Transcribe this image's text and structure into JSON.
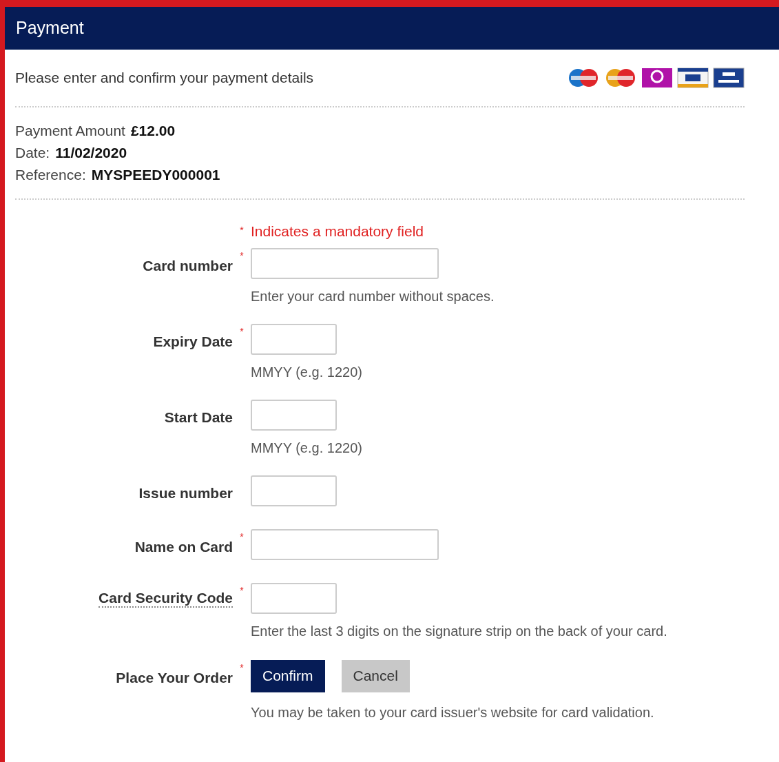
{
  "header": {
    "title": "Payment"
  },
  "intro": "Please enter and confirm your payment details",
  "card_logos": [
    {
      "kind": "circles",
      "color": "#1a73c9"
    },
    {
      "kind": "circles",
      "color": "#e8a21a"
    },
    {
      "kind": "swirl",
      "color": "#b012a8"
    },
    {
      "kind": "striped",
      "color": "#1a3f8f"
    },
    {
      "kind": "plain",
      "color": "#1a3f8f"
    }
  ],
  "summary": [
    {
      "label": "Payment Amount",
      "value": "£12.00"
    },
    {
      "label": "Date:",
      "value": "11/02/2020"
    },
    {
      "label": "Reference:",
      "value": "MYSPEEDY000001"
    }
  ],
  "mandatory_note": {
    "mark": "*",
    "text": "Indicates a mandatory field"
  },
  "fields": [
    {
      "label": "Card number",
      "required": true,
      "kind": "wide",
      "dotted": false,
      "help": "Enter your card number without spaces."
    },
    {
      "label": "Expiry Date",
      "required": true,
      "kind": "short",
      "dotted": false,
      "help": "MMYY (e.g. 1220)"
    },
    {
      "label": "Start Date",
      "required": false,
      "kind": "short",
      "dotted": false,
      "help": "MMYY (e.g. 1220)"
    },
    {
      "label": "Issue number",
      "required": false,
      "kind": "short",
      "dotted": false
    },
    {
      "label": "Name on Card",
      "required": true,
      "kind": "wide",
      "dotted": false
    },
    {
      "label": "Card Security Code",
      "required": true,
      "kind": "short",
      "dotted": true,
      "help": "Enter the last 3 digits on the signature strip on the back of your card."
    }
  ],
  "order": {
    "label": "Place Your Order",
    "required": true,
    "buttons": [
      {
        "label": "Confirm",
        "kind": "primary"
      },
      {
        "label": "Cancel",
        "kind": "secondary"
      }
    ],
    "help": "You may be taken to your card issuer's website for card validation."
  }
}
